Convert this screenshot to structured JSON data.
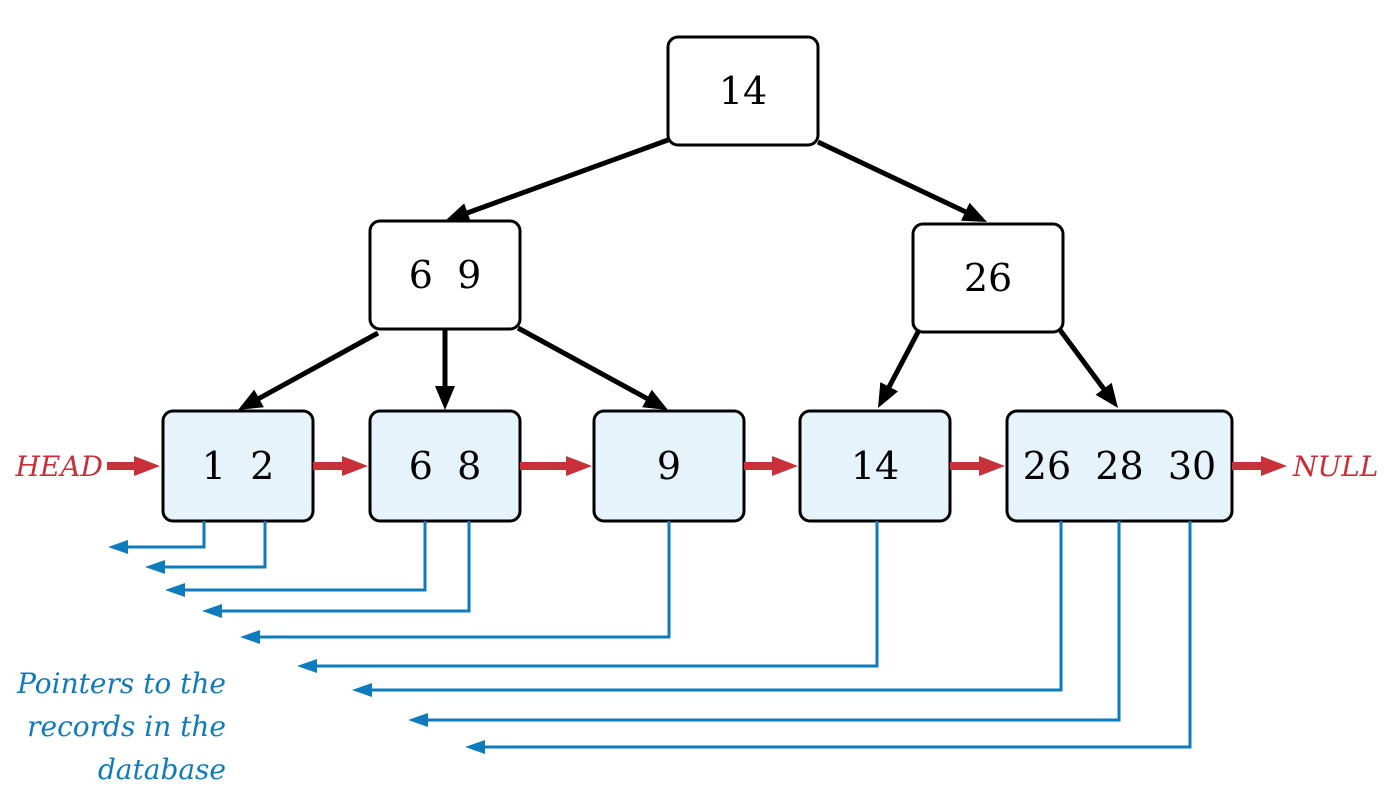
{
  "colors": {
    "link_arrow": "#c8303a",
    "pointer": "#0e7bbd",
    "leaf_fill": "#e6f3fb",
    "edge": "#000000"
  },
  "tree": {
    "root": {
      "keys": "14"
    },
    "internal": [
      {
        "keys": "6  9"
      },
      {
        "keys": "26"
      }
    ],
    "leaves": [
      {
        "keys": "1  2"
      },
      {
        "keys": "6  8"
      },
      {
        "keys": "9"
      },
      {
        "keys": "14"
      },
      {
        "keys": "26  28  30"
      }
    ]
  },
  "labels": {
    "head": "HEAD",
    "null": "NULL"
  },
  "caption": {
    "lines": [
      "Pointers to the",
      "records in the",
      "database"
    ]
  }
}
